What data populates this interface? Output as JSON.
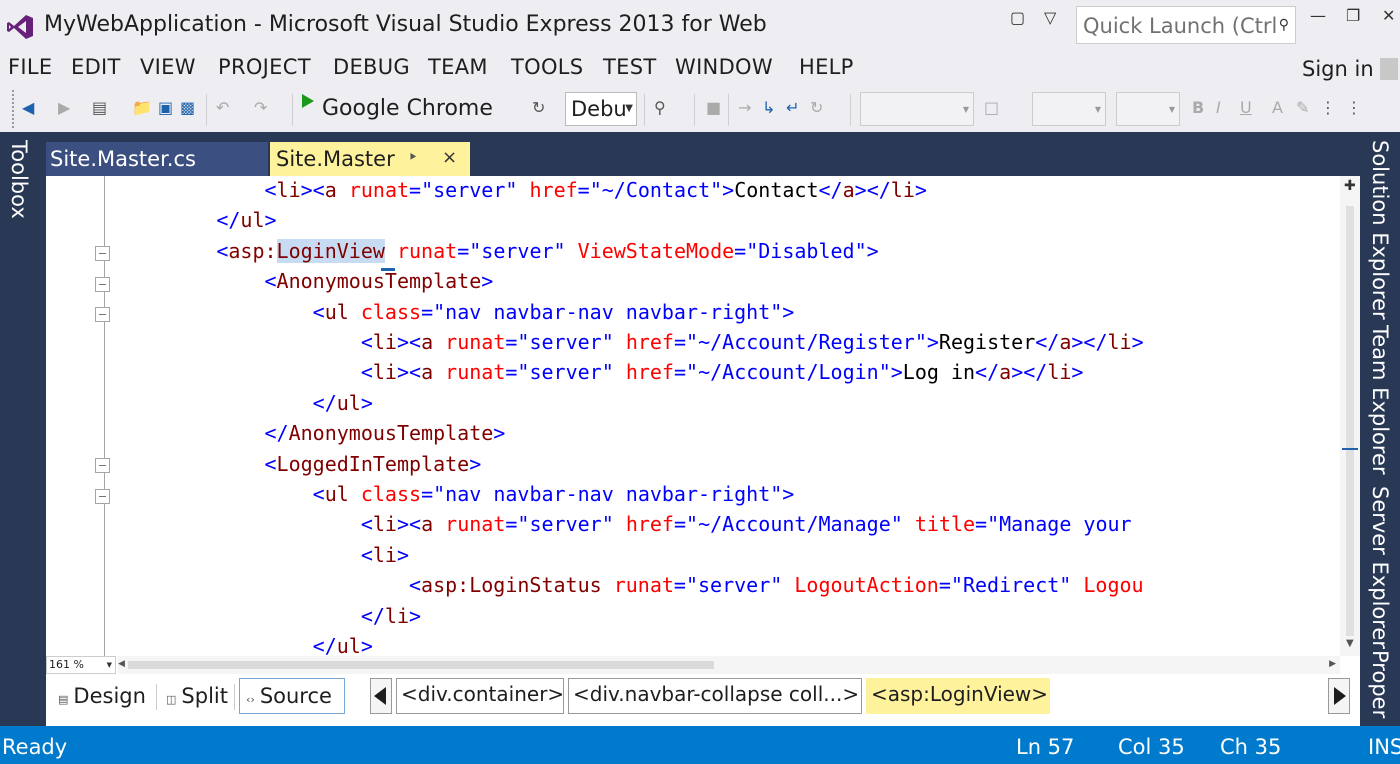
{
  "window": {
    "title": "MyWebApplication - Microsoft Visual Studio Express 2013 for Web",
    "quick_launch_placeholder": "Quick Launch (Ctrl",
    "sign_in": "Sign in"
  },
  "menu": [
    "FILE",
    "EDIT",
    "VIEW",
    "PROJECT",
    "DEBUG",
    "TEAM",
    "TOOLS",
    "TEST",
    "WINDOW",
    "HELP"
  ],
  "toolbar": {
    "browser": "Google Chrome",
    "configuration": "Debu"
  },
  "side_panels": {
    "left": "Toolbox",
    "right": [
      "Solution Explorer",
      "Team Explorer",
      "Server Explorer",
      "Proper"
    ]
  },
  "tabs": [
    {
      "label": "Site.Master.cs",
      "active": false
    },
    {
      "label": "Site.Master",
      "active": true
    }
  ],
  "code_lines": [
    [
      [
        "tg",
        "            "
      ],
      [
        "br",
        "<"
      ],
      [
        "tg",
        "li"
      ],
      [
        "br",
        "><"
      ],
      [
        "tg",
        "a"
      ],
      [
        "tx",
        " "
      ],
      [
        "at",
        "runat"
      ],
      [
        "br",
        "=\""
      ],
      [
        "va",
        "server"
      ],
      [
        "br",
        "\""
      ],
      [
        "tx",
        " "
      ],
      [
        "at",
        "href"
      ],
      [
        "br",
        "=\""
      ],
      [
        "va",
        "~/Contact"
      ],
      [
        "br",
        "\">"
      ],
      [
        "tx",
        "Contact"
      ],
      [
        "br",
        "</"
      ],
      [
        "tg",
        "a"
      ],
      [
        "br",
        "></"
      ],
      [
        "tg",
        "li"
      ],
      [
        "br",
        ">"
      ]
    ],
    [
      [
        "tg",
        "        "
      ],
      [
        "br",
        "</"
      ],
      [
        "tg",
        "ul"
      ],
      [
        "br",
        ">"
      ]
    ],
    [
      [
        "tg",
        "        "
      ],
      [
        "br",
        "<"
      ],
      [
        "tg",
        "asp:"
      ],
      [
        "hl",
        "LoginView"
      ],
      [
        "tx",
        " "
      ],
      [
        "at",
        "runat"
      ],
      [
        "br",
        "=\""
      ],
      [
        "va",
        "server"
      ],
      [
        "br",
        "\""
      ],
      [
        "tx",
        " "
      ],
      [
        "at",
        "ViewStateMode"
      ],
      [
        "br",
        "=\""
      ],
      [
        "va",
        "Disabled"
      ],
      [
        "br",
        "\">"
      ]
    ],
    [
      [
        "tg",
        "            "
      ],
      [
        "br",
        "<"
      ],
      [
        "tg",
        "AnonymousTemplate"
      ],
      [
        "br",
        ">"
      ]
    ],
    [
      [
        "tg",
        "                "
      ],
      [
        "br",
        "<"
      ],
      [
        "tg",
        "ul"
      ],
      [
        "tx",
        " "
      ],
      [
        "at",
        "class"
      ],
      [
        "br",
        "=\""
      ],
      [
        "va",
        "nav navbar-nav navbar-right"
      ],
      [
        "br",
        "\">"
      ]
    ],
    [
      [
        "tg",
        "                    "
      ],
      [
        "br",
        "<"
      ],
      [
        "tg",
        "li"
      ],
      [
        "br",
        "><"
      ],
      [
        "tg",
        "a"
      ],
      [
        "tx",
        " "
      ],
      [
        "at",
        "runat"
      ],
      [
        "br",
        "=\""
      ],
      [
        "va",
        "server"
      ],
      [
        "br",
        "\""
      ],
      [
        "tx",
        " "
      ],
      [
        "at",
        "href"
      ],
      [
        "br",
        "=\""
      ],
      [
        "va",
        "~/Account/Register"
      ],
      [
        "br",
        "\">"
      ],
      [
        "tx",
        "Register"
      ],
      [
        "br",
        "</"
      ],
      [
        "tg",
        "a"
      ],
      [
        "br",
        "></"
      ],
      [
        "tg",
        "li"
      ],
      [
        "br",
        ">"
      ]
    ],
    [
      [
        "tg",
        "                    "
      ],
      [
        "br",
        "<"
      ],
      [
        "tg",
        "li"
      ],
      [
        "br",
        "><"
      ],
      [
        "tg",
        "a"
      ],
      [
        "tx",
        " "
      ],
      [
        "at",
        "runat"
      ],
      [
        "br",
        "=\""
      ],
      [
        "va",
        "server"
      ],
      [
        "br",
        "\""
      ],
      [
        "tx",
        " "
      ],
      [
        "at",
        "href"
      ],
      [
        "br",
        "=\""
      ],
      [
        "va",
        "~/Account/Login"
      ],
      [
        "br",
        "\">"
      ],
      [
        "tx",
        "Log in"
      ],
      [
        "br",
        "</"
      ],
      [
        "tg",
        "a"
      ],
      [
        "br",
        "></"
      ],
      [
        "tg",
        "li"
      ],
      [
        "br",
        ">"
      ]
    ],
    [
      [
        "tg",
        "                "
      ],
      [
        "br",
        "</"
      ],
      [
        "tg",
        "ul"
      ],
      [
        "br",
        ">"
      ]
    ],
    [
      [
        "tg",
        "            "
      ],
      [
        "br",
        "</"
      ],
      [
        "tg",
        "AnonymousTemplate"
      ],
      [
        "br",
        ">"
      ]
    ],
    [
      [
        "tg",
        "            "
      ],
      [
        "br",
        "<"
      ],
      [
        "tg",
        "LoggedInTemplate"
      ],
      [
        "br",
        ">"
      ]
    ],
    [
      [
        "tg",
        "                "
      ],
      [
        "br",
        "<"
      ],
      [
        "tg",
        "ul"
      ],
      [
        "tx",
        " "
      ],
      [
        "at",
        "class"
      ],
      [
        "br",
        "=\""
      ],
      [
        "va",
        "nav navbar-nav navbar-right"
      ],
      [
        "br",
        "\">"
      ]
    ],
    [
      [
        "tg",
        "                    "
      ],
      [
        "br",
        "<"
      ],
      [
        "tg",
        "li"
      ],
      [
        "br",
        "><"
      ],
      [
        "tg",
        "a"
      ],
      [
        "tx",
        " "
      ],
      [
        "at",
        "runat"
      ],
      [
        "br",
        "=\""
      ],
      [
        "va",
        "server"
      ],
      [
        "br",
        "\""
      ],
      [
        "tx",
        " "
      ],
      [
        "at",
        "href"
      ],
      [
        "br",
        "=\""
      ],
      [
        "va",
        "~/Account/Manage"
      ],
      [
        "br",
        "\""
      ],
      [
        "tx",
        " "
      ],
      [
        "at",
        "title"
      ],
      [
        "br",
        "=\""
      ],
      [
        "va",
        "Manage your"
      ]
    ],
    [
      [
        "tg",
        "                    "
      ],
      [
        "br",
        "<"
      ],
      [
        "tg",
        "li"
      ],
      [
        "br",
        ">"
      ]
    ],
    [
      [
        "tg",
        "                        "
      ],
      [
        "br",
        "<"
      ],
      [
        "tg",
        "asp:LoginStatus"
      ],
      [
        "tx",
        " "
      ],
      [
        "at",
        "runat"
      ],
      [
        "br",
        "=\""
      ],
      [
        "va",
        "server"
      ],
      [
        "br",
        "\""
      ],
      [
        "tx",
        " "
      ],
      [
        "at",
        "LogoutAction"
      ],
      [
        "br",
        "=\""
      ],
      [
        "va",
        "Redirect"
      ],
      [
        "br",
        "\""
      ],
      [
        "tx",
        " "
      ],
      [
        "at",
        "Logou"
      ]
    ],
    [
      [
        "tg",
        "                    "
      ],
      [
        "br",
        "</"
      ],
      [
        "tg",
        "li"
      ],
      [
        "br",
        ">"
      ]
    ],
    [
      [
        "tg",
        "                "
      ],
      [
        "br",
        "</"
      ],
      [
        "tg",
        "ul"
      ],
      [
        "br",
        ">"
      ]
    ]
  ],
  "editor": {
    "zoom": "161 %"
  },
  "view_modes": {
    "design": "Design",
    "split": "Split",
    "source": "Source"
  },
  "breadcrumbs": [
    "<div.container>",
    "<div.navbar-collapse coll...>",
    "<asp:LoginView>"
  ],
  "status": {
    "ready": "Ready",
    "line": "Ln 57",
    "col": "Col 35",
    "ch": "Ch 35",
    "mode": "INS"
  },
  "colors": {
    "status_bar": "#007acc",
    "dark_frame": "#293955",
    "active_tab": "#fff29d"
  }
}
